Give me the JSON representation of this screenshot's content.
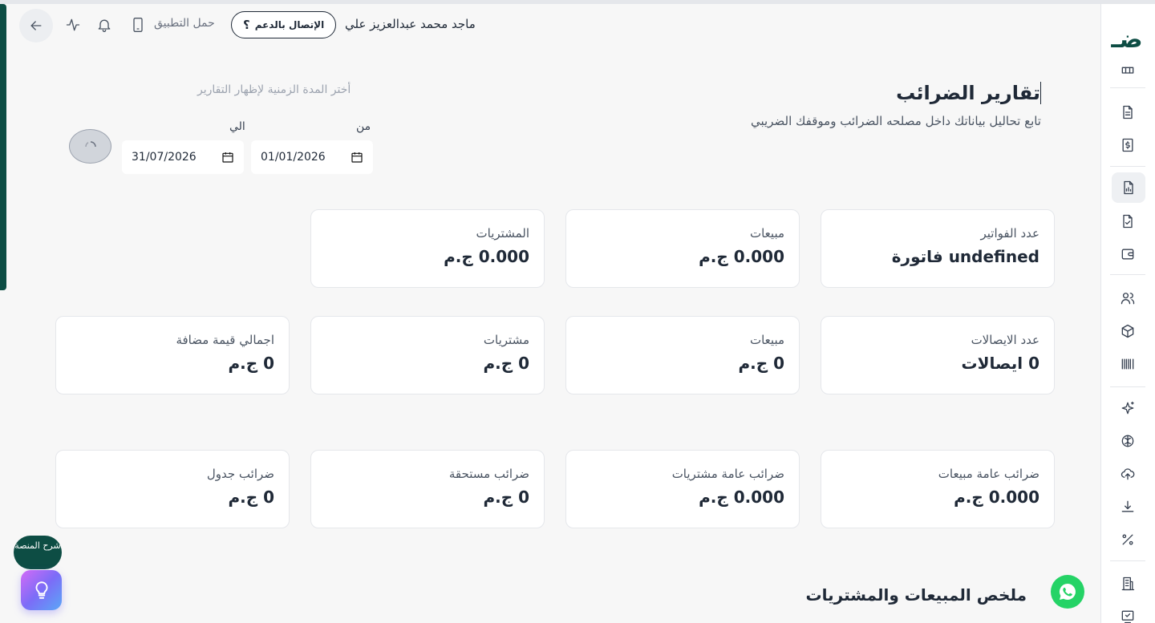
{
  "topbar": {
    "user_name": "ماجد محمد عبدالعزيز علي",
    "support_label": "الإتصال بالدعم",
    "download_app_label": "حمل التطبيق"
  },
  "header": {
    "title": "تقارير الضرائب",
    "subtitle": "تابع تحاليل بياناتك داخل مصلحه الضرائب وموقفك الضريبي"
  },
  "period": {
    "label": "أختر المدة الزمنية لإظهار التقارير",
    "from_label": "من",
    "to_label": "الي",
    "from_value": "01/01/2026",
    "to_value": "31/07/2026"
  },
  "cards_row1": [
    {
      "label": "عدد الفواتير",
      "value": "undefined فاتورة"
    },
    {
      "label": "مبيعات",
      "value": "0.000 ج.م"
    },
    {
      "label": "المشتريات",
      "value": "0.000 ج.م"
    }
  ],
  "cards_row2": [
    {
      "label": "عدد الايصالات",
      "value": "0 ايصالات"
    },
    {
      "label": "مبيعات",
      "value": "0 ج.م"
    },
    {
      "label": "مشتريات",
      "value": "0 ج.م"
    },
    {
      "label": "اجمالي قيمة مضافة",
      "value": "0 ج.م"
    }
  ],
  "cards_row3": [
    {
      "label": "ضرائب عامة مبيعات",
      "value": "0.000 ج.م"
    },
    {
      "label": "ضرائب عامة مشتريات",
      "value": "0.000 ج.م"
    },
    {
      "label": "ضرائب مستحقة",
      "value": "0 ج.م"
    },
    {
      "label": "ضرائب جدول",
      "value": "0 ج.م"
    }
  ],
  "summary": {
    "title": "ملخص المبيعات والمشتريات"
  },
  "helper": {
    "explain_label": "شرح المنصة"
  },
  "brand": {
    "logo_text": "ضـ",
    "accent_color": "#0d4d44"
  },
  "icons": {
    "rail": [
      "table-icon",
      "document-icon",
      "invoice-dollar-icon",
      "report-chart-icon",
      "file-check-icon",
      "wallet-icon",
      "users-icon",
      "box-icon",
      "barcode-icon",
      "sparkles-icon",
      "brain-icon",
      "upload-cloud-icon",
      "download-icon",
      "percent-icon",
      "building-icon",
      "checklist-icon"
    ],
    "topbar": [
      "back-arrow-icon",
      "activity-icon",
      "bell-icon",
      "phone-icon",
      "question-icon"
    ]
  }
}
